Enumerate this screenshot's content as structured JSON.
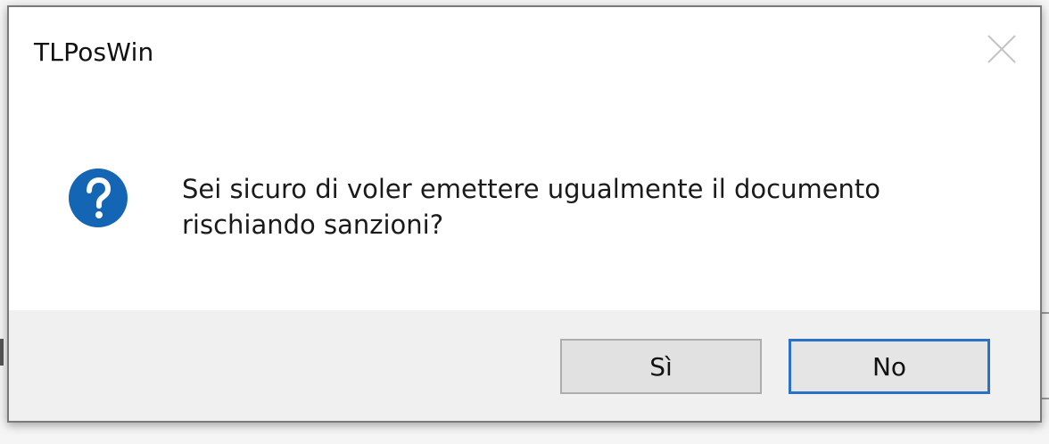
{
  "window": {
    "title": "TLPosWin"
  },
  "message": {
    "line1": "Sei sicuro di voler emettere ugualmente il documento",
    "line2": "rischiando sanzioni?"
  },
  "buttons": {
    "yes_label": "Sì",
    "no_label": "No",
    "default": "no"
  },
  "icons": {
    "dialog_icon": "question-icon",
    "close_icon": "close-icon"
  },
  "colors": {
    "icon_blue": "#1565b5",
    "default_button_border": "#2c71c9"
  }
}
